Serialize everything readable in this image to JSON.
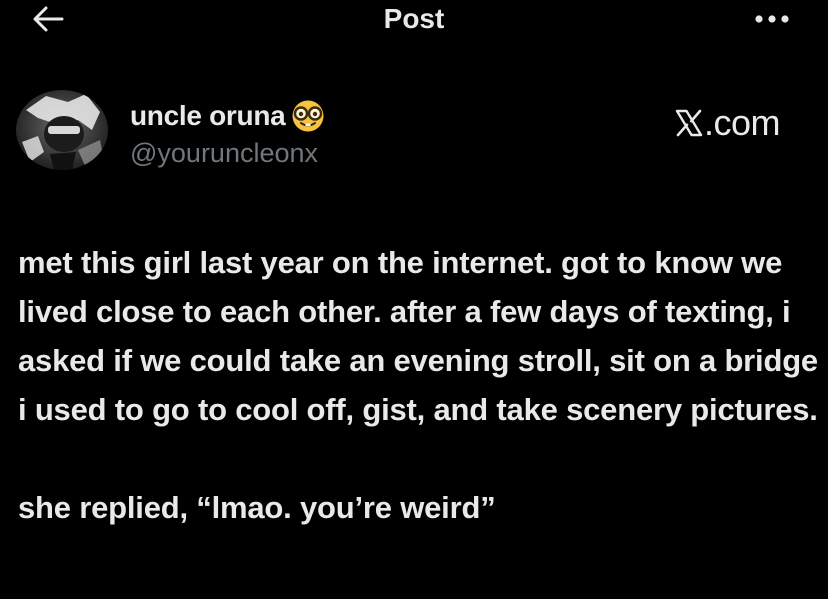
{
  "header": {
    "title": "Post",
    "back_icon": "arrow-left-icon",
    "more_icon": "more-horizontal-icon"
  },
  "author": {
    "display_name": "uncle oruna",
    "emoji": "nerd-face-emoji",
    "handle": "@youruncleonx",
    "avatar": "avatar"
  },
  "watermark": {
    "text": ".com",
    "logo_icon": "x-logo-icon"
  },
  "post": {
    "paragraphs": [
      "met this girl last year on the internet. got to know we lived close to each other. after a few days of texting, i asked if we could take an evening stroll, sit on a bridge i used to go to cool off, gist, and take scenery pictures.",
      "she replied, “lmao. you’re weird”"
    ]
  },
  "colors": {
    "background": "#000000",
    "primary_text": "#e7e9ea",
    "secondary_text": "#71767b",
    "emoji_yellow": "#f7c33e"
  }
}
